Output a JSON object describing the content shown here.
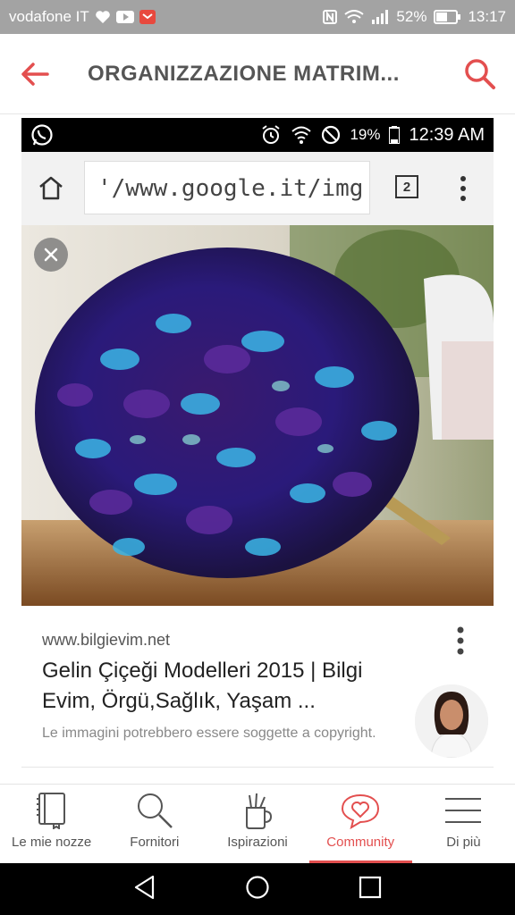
{
  "statusbar": {
    "carrier": "vodafone IT",
    "battery": "52%",
    "time": "13:17"
  },
  "appbar": {
    "title": "ORGANIZZAZIONE MATRIM..."
  },
  "screenshot": {
    "statusbar": {
      "battery": "19%",
      "time": "12:39 AM"
    },
    "browser": {
      "url": "'/www.google.it/img",
      "tab_count": "2"
    },
    "result": {
      "domain": "www.bilgievim.net",
      "title": "Gelin Çiçeği Modelleri 2015 | Bilgi Evim, Örgü,Sağlık, Yaşam ...",
      "copyright": "Le immagini potrebbero essere soggette a copyright."
    }
  },
  "bottomnav": {
    "items": [
      {
        "label": "Le mie nozze",
        "icon": "book-icon"
      },
      {
        "label": "Fornitori",
        "icon": "search-icon"
      },
      {
        "label": "Ispirazioni",
        "icon": "brush-cup-icon"
      },
      {
        "label": "Community",
        "icon": "heart-chat-icon",
        "active": true
      },
      {
        "label": "Di più",
        "icon": "menu-icon"
      }
    ]
  },
  "colors": {
    "accent": "#e34f4f",
    "statusbar": "#a3a3a3"
  }
}
